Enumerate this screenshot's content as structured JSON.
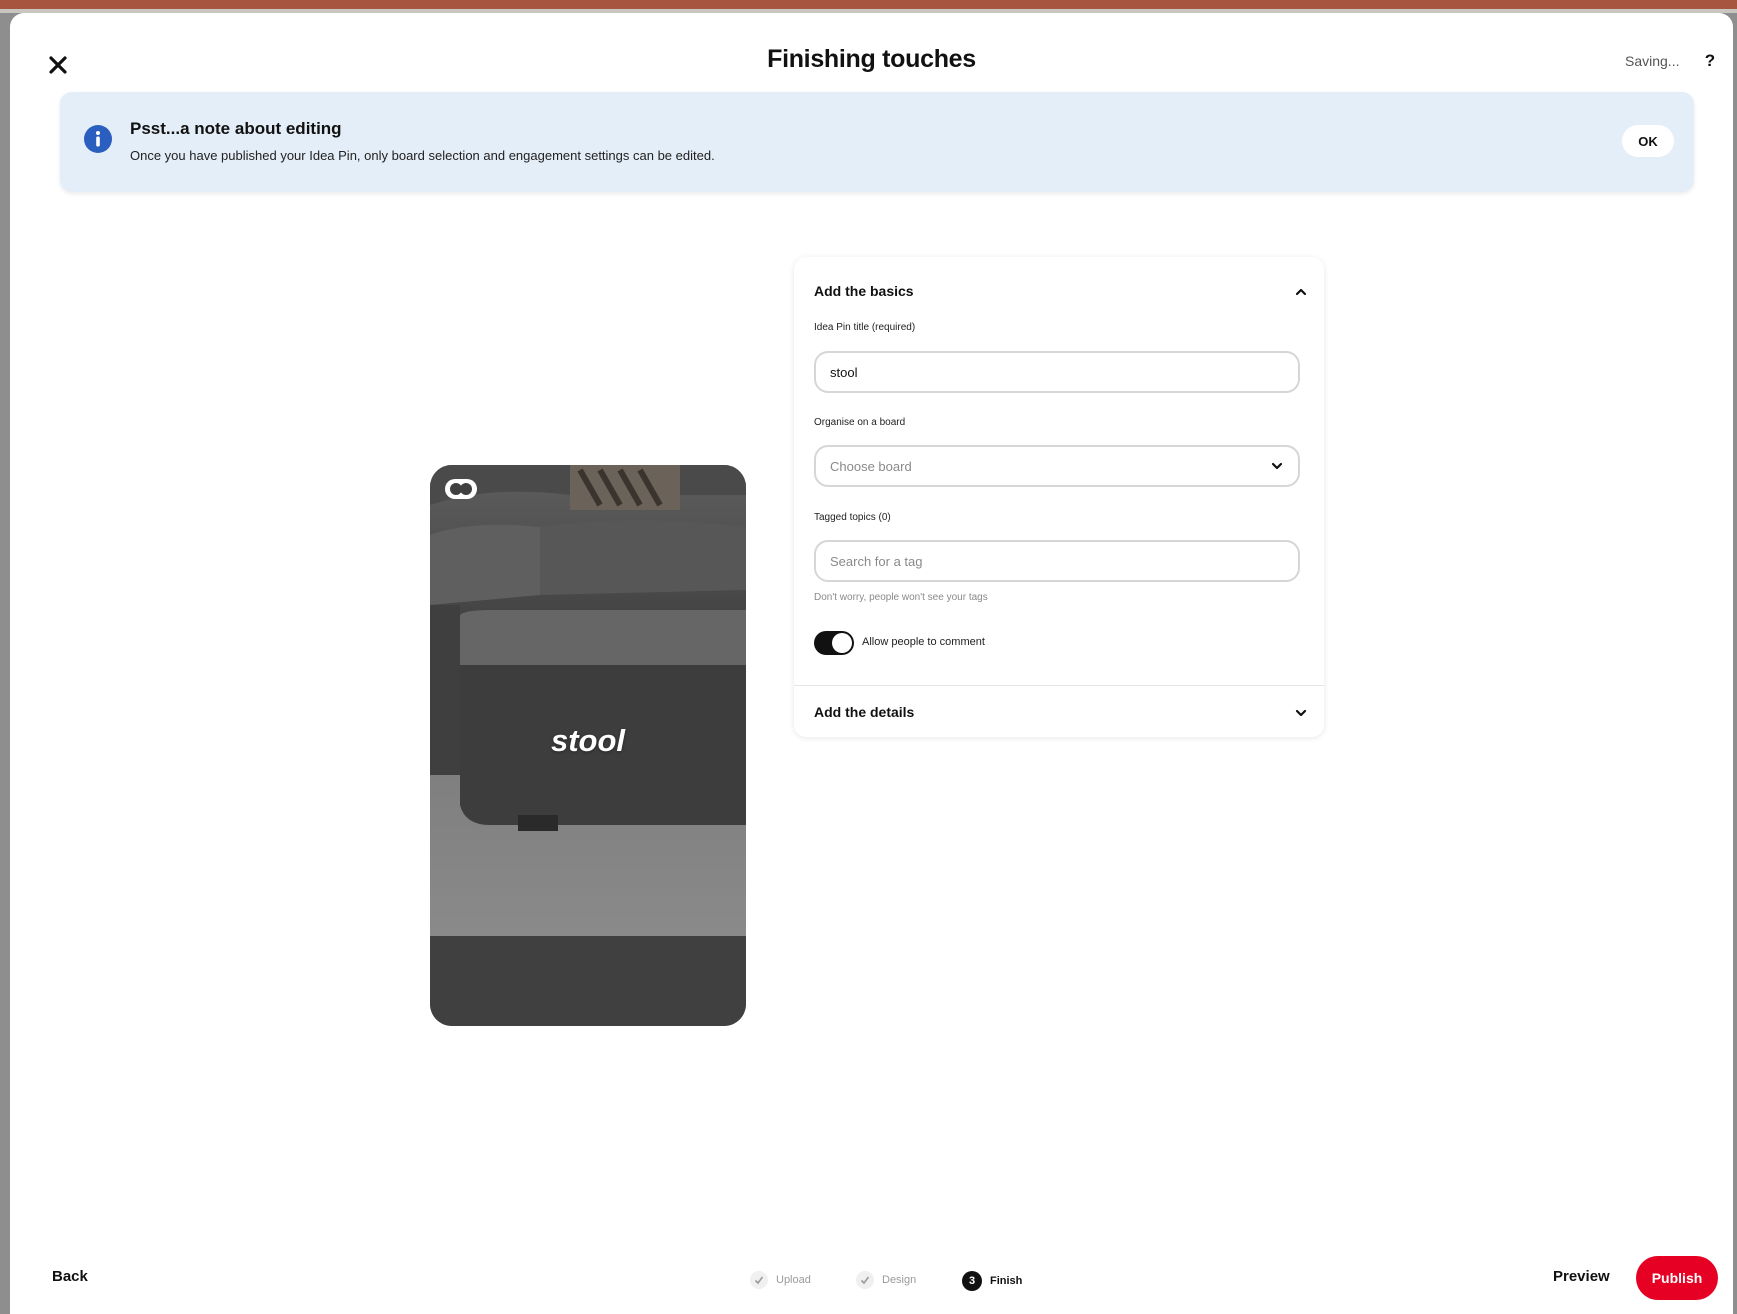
{
  "header": {
    "title": "Finishing touches",
    "status": "Saving...",
    "help_label": "?"
  },
  "banner": {
    "title": "Psst...a note about editing",
    "text": "Once you have published your Idea Pin, only board selection and engagement settings can be edited.",
    "ok_label": "OK"
  },
  "preview": {
    "overlay_text": "stool"
  },
  "form": {
    "basics_heading": "Add the basics",
    "title_label": "Idea Pin title (required)",
    "title_value": "stool",
    "board_label": "Organise on a board",
    "board_placeholder": "Choose board",
    "tags_label": "Tagged topics (0)",
    "tags_placeholder": "Search for a tag",
    "tags_helper": "Don't worry, people won't see your tags",
    "comments_toggle_label": "Allow people to comment",
    "comments_enabled": true,
    "details_heading": "Add the details"
  },
  "footer": {
    "back_label": "Back",
    "steps": [
      {
        "label": "Upload",
        "state": "done"
      },
      {
        "label": "Design",
        "state": "done"
      },
      {
        "label": "Finish",
        "state": "current",
        "number": "3"
      }
    ],
    "preview_label": "Preview",
    "publish_label": "Publish"
  },
  "colors": {
    "publish": "#e60023",
    "banner_bg": "#e4eef8",
    "info_icon": "#2b5fbf"
  }
}
